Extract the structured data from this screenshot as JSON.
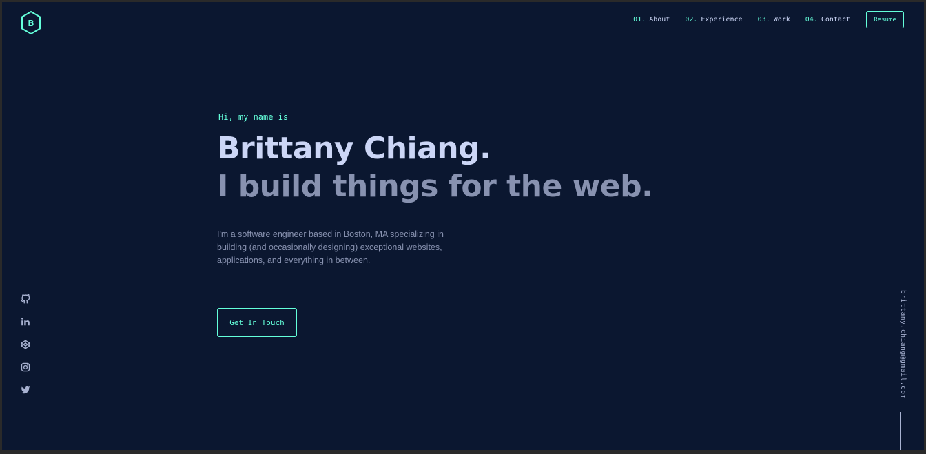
{
  "header": {
    "logo_letter": "B",
    "nav": [
      {
        "num": "01.",
        "label": "About"
      },
      {
        "num": "02.",
        "label": "Experience"
      },
      {
        "num": "03.",
        "label": "Work"
      },
      {
        "num": "04.",
        "label": "Contact"
      }
    ],
    "resume_label": "Resume"
  },
  "hero": {
    "greeting": "Hi, my name is",
    "name": "Brittany Chiang.",
    "tagline": "I build things for the web.",
    "description": "I'm a software engineer based in Boston, MA specializing in building (and occasionally designing) exceptional websites, applications, and everything in between.",
    "cta_label": "Get In Touch"
  },
  "social": {
    "icons": [
      "github-icon",
      "linkedin-icon",
      "codepen-icon",
      "instagram-icon",
      "twitter-icon"
    ]
  },
  "email": "brittany.chiang@gmail.com",
  "colors": {
    "background": "#0b1730",
    "accent": "#64ffda",
    "heading": "#ccd6f6",
    "text": "#8892b0"
  }
}
